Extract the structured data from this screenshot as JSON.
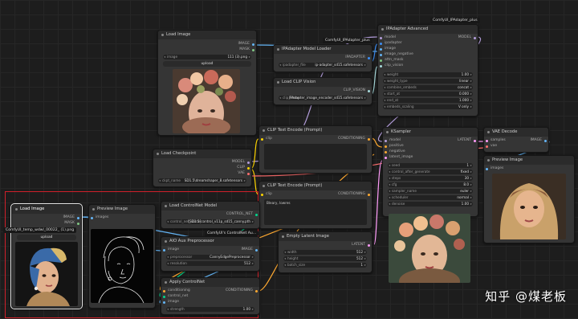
{
  "colors": {
    "model": "#b39ddb",
    "clip": "#ffd500",
    "conditioning": "#ffa931",
    "image": "#64b5f6",
    "mask": "#81c784",
    "latent": "#ff9cf9",
    "vae": "#ff6e6e",
    "control_net": "#00d78d",
    "ipadapter": "#3d8ef5",
    "clip_vision": "#a8dadc"
  },
  "tags": {
    "ipadapter_plus_top": "ComfyUI_IPAdapter_plus",
    "ipadapter_plus_loader": "ComfyUI_IPAdapter_plus",
    "comfyui_custom": "ComfyUI's ControlNet Au...",
    "filename_tag": "ComfyUI_temp_wdwl_00022_ (1).png"
  },
  "load_image_top": {
    "title": "Load Image",
    "out_image": "IMAGE",
    "out_mask": "MASK",
    "image_label": "image",
    "image_value": "111 (3).png",
    "upload": "upload"
  },
  "ipadapter_loader": {
    "title": "IPAdapter Model Loader",
    "out": "IPADAPTER",
    "field_label": "ipadapter_file",
    "field_value": "ip-adapter_sd15.safetensors"
  },
  "clip_vision": {
    "title": "Load CLIP Vision",
    "out": "CLIP_VISION",
    "field_label": "clip_name",
    "field_value": "IPAdapter_image_encoder_sd15.safetensors"
  },
  "ipadapter_adv": {
    "title": "IPAdapter Advanced",
    "out": "MODEL",
    "inputs": [
      "model",
      "ipadapter",
      "image",
      "image_negative",
      "attn_mask",
      "clip_vision"
    ],
    "widgets": [
      {
        "k": "weight",
        "v": "1.00"
      },
      {
        "k": "weight_type",
        "v": "linear"
      },
      {
        "k": "combine_embeds",
        "v": "concat"
      },
      {
        "k": "start_at",
        "v": "0.000"
      },
      {
        "k": "end_at",
        "v": "1.000"
      },
      {
        "k": "embeds_scaling",
        "v": "V only"
      }
    ]
  },
  "clip_pos": {
    "title": "CLIP Text Encode (Prompt)",
    "in": "clip",
    "out": "CONDITIONING",
    "text": ""
  },
  "clip_neg": {
    "title": "CLIP Text Encode (Prompt)",
    "in": "clip",
    "out": "CONDITIONING",
    "text": "Bleary, lowres"
  },
  "checkpoint": {
    "title": "Load Checkpoint",
    "out_model": "MODEL",
    "out_clip": "CLIP",
    "out_vae": "VAE",
    "field_label": "ckpt_name",
    "field_value": "SD1.5\\dreamshaper_8.safetensors"
  },
  "ksampler": {
    "title": "KSampler",
    "out": "LATENT",
    "inputs": [
      "model",
      "positive",
      "negative",
      "latent_image"
    ],
    "widgets": [
      {
        "k": "seed",
        "v": "1"
      },
      {
        "k": "control_after_generate",
        "v": "fixed"
      },
      {
        "k": "steps",
        "v": "30"
      },
      {
        "k": "cfg",
        "v": "8.0"
      },
      {
        "k": "sampler_name",
        "v": "euler"
      },
      {
        "k": "scheduler",
        "v": "normal"
      },
      {
        "k": "denoise",
        "v": "1.00"
      }
    ]
  },
  "vae_decode": {
    "title": "VAE Decode",
    "in_samples": "samples",
    "in_vae": "vae",
    "out": "IMAGE"
  },
  "preview_right": {
    "title": "Preview Image",
    "in": "images"
  },
  "controlnet_loader": {
    "title": "Load ControlNet Model",
    "out": "CONTROL_NET",
    "field_label": "control_net_name",
    "field_value": "[SD1.5]control_v11p_sd15_canny.pth"
  },
  "aio": {
    "title": "AIO Aux Preprocessor",
    "in": "image",
    "out": "IMAGE",
    "widgets": [
      {
        "k": "preprocessor",
        "v": "CannyEdgePreprocessor"
      },
      {
        "k": "resolution",
        "v": "512"
      }
    ]
  },
  "apply_cn": {
    "title": "Apply ControlNet",
    "inputs": [
      "conditioning",
      "control_net",
      "image"
    ],
    "out": "CONDITIONING",
    "widgets": [
      {
        "k": "strength",
        "v": "1.00"
      }
    ]
  },
  "load_image_bottom": {
    "title": "Load Image",
    "out_image": "IMAGE",
    "out_mask": "MASK",
    "upload": "upload"
  },
  "preview_bottom": {
    "title": "Preview Image",
    "in": "images"
  },
  "empty_latent": {
    "title": "Empty Latent Image",
    "out": "LATENT",
    "widgets": [
      {
        "k": "width",
        "v": "512"
      },
      {
        "k": "height",
        "v": "512"
      },
      {
        "k": "batch_size",
        "v": "1"
      }
    ]
  },
  "watermark": "知乎 @煤老板"
}
